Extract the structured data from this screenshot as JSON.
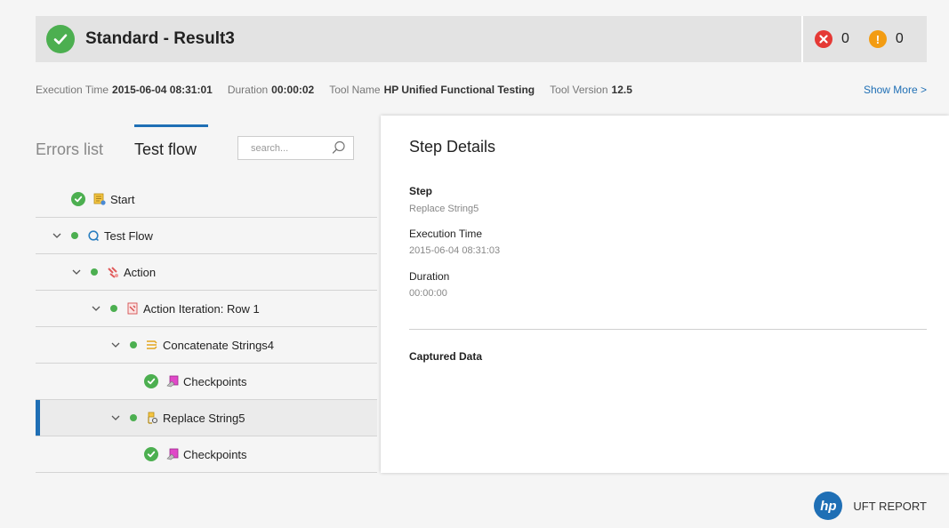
{
  "header": {
    "title": "Standard - Result3",
    "error_count": "0",
    "warning_count": "0"
  },
  "meta": {
    "execution_time_label": "Execution Time",
    "execution_time_value": "2015-06-04 08:31:01",
    "duration_label": "Duration",
    "duration_value": "00:00:02",
    "tool_name_label": "Tool Name",
    "tool_name_value": "HP Unified Functional Testing",
    "tool_version_label": "Tool Version",
    "tool_version_value": "12.5",
    "show_more": "Show More >"
  },
  "tabs": {
    "errors_list": "Errors list",
    "test_flow": "Test flow",
    "active": "test_flow"
  },
  "search": {
    "placeholder": "search..."
  },
  "tree": {
    "rows": [
      {
        "label": "Start",
        "depth": 0,
        "expandable": false,
        "status": "passed",
        "icon": "start-icon"
      },
      {
        "label": "Test Flow",
        "depth": 0,
        "expandable": true,
        "status": "passed",
        "icon": "test-flow-icon"
      },
      {
        "label": "Action",
        "depth": 1,
        "expandable": true,
        "status": "passed",
        "icon": "action-icon"
      },
      {
        "label": "Action Iteration: Row 1",
        "depth": 2,
        "expandable": true,
        "status": "passed",
        "icon": "iteration-icon"
      },
      {
        "label": "Concatenate Strings4",
        "depth": 3,
        "expandable": true,
        "status": "passed",
        "icon": "concatenate-icon"
      },
      {
        "label": "Checkpoints",
        "depth": 4,
        "expandable": false,
        "status": "passed",
        "icon": "checkpoint-icon"
      },
      {
        "label": "Replace String5",
        "depth": 3,
        "expandable": true,
        "status": "passed",
        "icon": "replace-icon",
        "selected": true
      },
      {
        "label": "Checkpoints",
        "depth": 4,
        "expandable": false,
        "status": "passed",
        "icon": "checkpoint-icon"
      }
    ]
  },
  "details": {
    "title": "Step Details",
    "step_label": "Step",
    "step_value": "Replace String5",
    "execution_time_label": "Execution Time",
    "execution_time_value": "2015-06-04 08:31:03",
    "duration_label": "Duration",
    "duration_value": "00:00:00",
    "captured_data_label": "Captured Data"
  },
  "footer": {
    "logo_text": "hp",
    "brand": "UFT REPORT"
  },
  "colors": {
    "accent": "#1f6fb5",
    "success": "#4caf50",
    "error": "#e53935",
    "warning": "#f39c12"
  }
}
